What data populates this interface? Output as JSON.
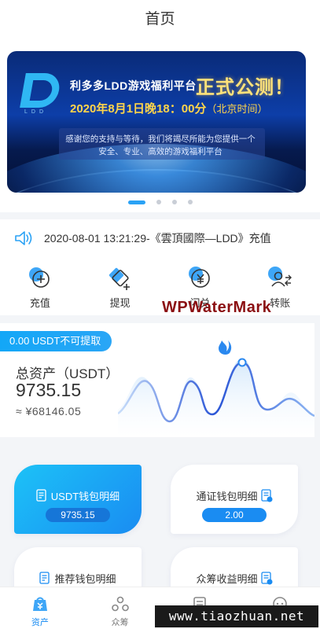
{
  "header": {
    "title": "首页"
  },
  "banner": {
    "logo_text": "LDD",
    "title": "利多多LDD游戏福利平台",
    "big_title": "正式公测！",
    "date_line": "2020年8月1日晚18：00分",
    "date_tail": "（北京时间）",
    "message": "感谢您的支持与等待，我们将竭尽所能为您提供一个安全、专业、高效的游戏福利平台",
    "carousel_count": 4,
    "carousel_active": 1
  },
  "notice": {
    "text": "2020-08-01 13:21:29-《雲頂國際—LDD》充值",
    "icon": "speaker-icon"
  },
  "actions": [
    {
      "label": "充值",
      "icon": "deposit-icon"
    },
    {
      "label": "提现",
      "icon": "withdraw-icon"
    },
    {
      "label": "闪兑",
      "icon": "exchange-icon"
    },
    {
      "label": "转账",
      "icon": "transfer-icon"
    }
  ],
  "watermark": "WPWaterMark",
  "asset": {
    "badge": "0.00 USDT不可提取",
    "label": "总资产（USDT）",
    "value": "9735.15",
    "cny": "≈ ¥68146.05"
  },
  "wallets": [
    {
      "title": "USDT钱包明细",
      "value": "9735.15"
    },
    {
      "title": "通证钱包明细",
      "value": "2.00"
    },
    {
      "title": "推荐钱包明细"
    },
    {
      "title": "众筹收益明细"
    }
  ],
  "tabs": [
    {
      "label": "资产",
      "icon": "wallet-icon",
      "active": true
    },
    {
      "label": "众筹",
      "icon": "crowdfund-icon",
      "active": false
    },
    {
      "label": "",
      "icon": "document-icon",
      "active": false
    },
    {
      "label": "",
      "icon": "chat-icon",
      "active": false
    }
  ],
  "site_mark": "www.tiaozhuan.net",
  "colors": {
    "accent": "#1a8cf2",
    "accent_light": "#1cc2f7",
    "text": "#333333",
    "background": "#f3f5f8",
    "watermark": "#8b0f12"
  }
}
